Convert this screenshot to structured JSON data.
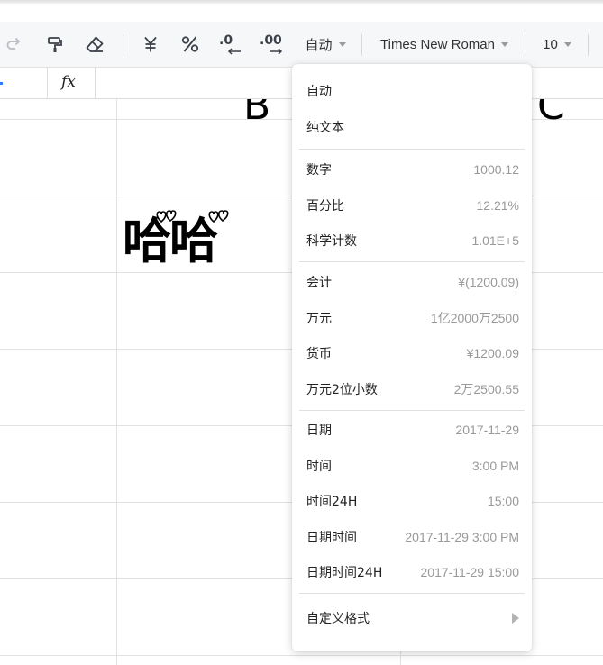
{
  "toolbar": {
    "number_format_label": "自动",
    "font_name": "Times New Roman",
    "font_size": "10",
    "decimal_decrease_label": ".0",
    "decimal_increase_label": ".00"
  },
  "formula_bar": {
    "fx_label": "fx"
  },
  "sheet": {
    "cell_text_top": "B",
    "cell_text_top_right": "C",
    "cell_text_big": "哈哈"
  },
  "format_menu": {
    "items": [
      {
        "label": "自动",
        "sample": ""
      },
      {
        "label": "纯文本",
        "sample": ""
      },
      {
        "label": "数字",
        "sample": "1000.12"
      },
      {
        "label": "百分比",
        "sample": "12.21%"
      },
      {
        "label": "科学计数",
        "sample": "1.01E+5"
      },
      {
        "label": "会计",
        "sample": "¥(1200.09)"
      },
      {
        "label": "万元",
        "sample": "1亿2000万2500"
      },
      {
        "label": "货币",
        "sample": "¥1200.09"
      },
      {
        "label": "万元2位小数",
        "sample": "2万2500.55"
      },
      {
        "label": "日期",
        "sample": "2017-11-29"
      },
      {
        "label": "时间",
        "sample": "3:00 PM"
      },
      {
        "label": "时间24H",
        "sample": "15:00"
      },
      {
        "label": "日期时间",
        "sample": "2017-11-29 3:00 PM"
      },
      {
        "label": "日期时间24H",
        "sample": "2017-11-29 15:00"
      },
      {
        "label": "自定义格式",
        "sample": ""
      }
    ]
  }
}
